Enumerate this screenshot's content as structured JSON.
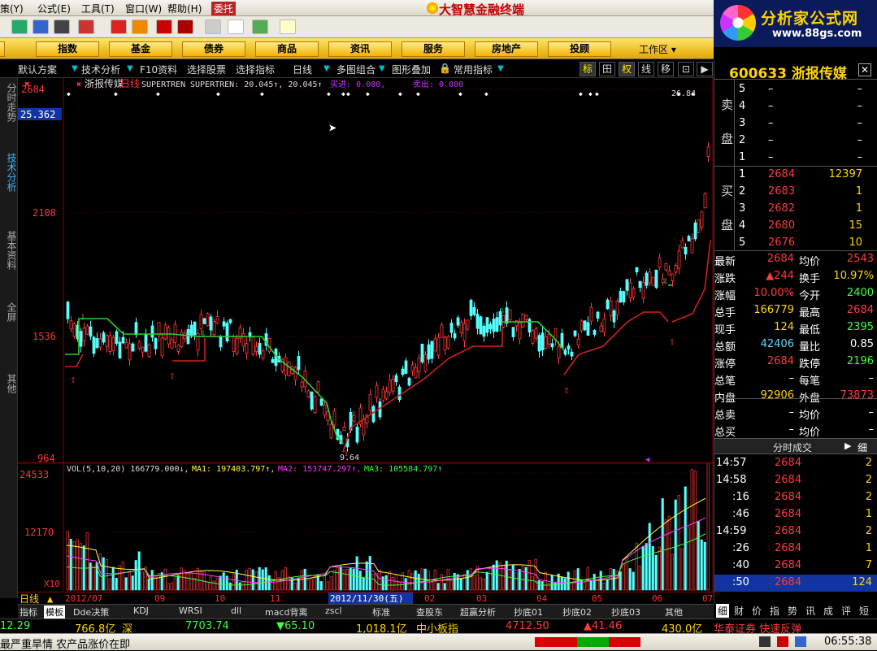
{
  "menu": {
    "items": [
      "策(Y)",
      "公式(E)",
      "工具(T)",
      "窗口(W)",
      "帮助(H)",
      "委托"
    ],
    "app_title": "大智慧金融终端"
  },
  "brand": {
    "name": "分析家公式网",
    "url": "www.88gs.com"
  },
  "categories": [
    "股",
    "指数",
    "基金",
    "债券",
    "商品",
    "资讯",
    "服务",
    "房地产",
    "投顾"
  ],
  "workarea_label": "工作区",
  "funcbar": {
    "items": [
      "默认方案",
      "技术分析",
      "F10资料",
      "选择股票",
      "选择指标",
      "日线",
      "多图组合",
      "图形叠加",
      "常用指标"
    ],
    "buttons": [
      "标",
      "田",
      "权",
      "线",
      "移"
    ]
  },
  "vtabs": [
    "分时走势",
    "技术分析",
    "基本资料",
    "全屏",
    "其他"
  ],
  "price_chart": {
    "header_name": "浙报传媒",
    "header_period": "日线",
    "indicator": "SUPERTREN",
    "indicator_line": "SUPERTREN: 20.045↑, 20.045↑",
    "buy_label": "买进: 0.000,",
    "sell_label": "卖出: 0.000",
    "y_labels": [
      "2684",
      "2108",
      "1536",
      "964"
    ],
    "cursor_value": "25.362",
    "high_mark": "26.84",
    "low_mark": "9.64"
  },
  "vol_chart": {
    "legend_vol": "VOL(5,10,20) 166779.000↓,",
    "legend_ma1": "MA1: 197403.797↑,",
    "legend_ma2": "MA2: 153747.297↑,",
    "legend_ma3": "MA3: 105584.797↑",
    "y_labels": [
      "24533",
      "12170",
      "X10"
    ]
  },
  "date_axis": {
    "labels": [
      "2012/07",
      "09",
      "10",
      "11",
      "2012/11/30(五)",
      "02",
      "03",
      "04",
      "05",
      "06",
      "07"
    ],
    "period_label": "日线"
  },
  "bottom_tabs": [
    "指标",
    "模板",
    "Dde决策",
    "KDJ",
    "WRSI",
    "dll",
    "macd背离",
    "zscl",
    "标准",
    "查股东",
    "超赢分析",
    "抄底01",
    "抄底02",
    "抄底03",
    "其他"
  ],
  "right_panel": {
    "stock_code": "600633",
    "stock_name": "浙报传媒",
    "sell_label": [
      "卖",
      "盘"
    ],
    "buy_label": [
      "买",
      "盘"
    ],
    "sell_rows": [
      {
        "level": "5",
        "price": "–",
        "vol": "–"
      },
      {
        "level": "4",
        "price": "–",
        "vol": "–"
      },
      {
        "level": "3",
        "price": "–",
        "vol": "–"
      },
      {
        "level": "2",
        "price": "–",
        "vol": "–"
      },
      {
        "level": "1",
        "price": "–",
        "vol": "–"
      }
    ],
    "buy_rows": [
      {
        "level": "1",
        "price": "2684",
        "vol": "12397"
      },
      {
        "level": "2",
        "price": "2683",
        "vol": "1"
      },
      {
        "level": "3",
        "price": "2682",
        "vol": "1"
      },
      {
        "level": "4",
        "price": "2680",
        "vol": "15"
      },
      {
        "level": "5",
        "price": "2676",
        "vol": "10"
      }
    ],
    "stats": [
      {
        "l1": "最新",
        "v1": "2684",
        "c1": "red",
        "l2": "均价",
        "v2": "2543",
        "c2": "red"
      },
      {
        "l1": "涨跌",
        "v1": "▲244",
        "c1": "red",
        "l2": "换手",
        "v2": "10.97%",
        "c2": "yellow"
      },
      {
        "l1": "涨幅",
        "v1": "10.00%",
        "c1": "red",
        "l2": "今开",
        "v2": "2400",
        "c2": "green"
      },
      {
        "l1": "总手",
        "v1": "166779",
        "c1": "yellow",
        "l2": "最高",
        "v2": "2684",
        "c2": "red"
      },
      {
        "l1": "现手",
        "v1": "124",
        "c1": "yellow",
        "l2": "最低",
        "v2": "2395",
        "c2": "green"
      },
      {
        "l1": "总额",
        "v1": "42406",
        "c1": "cyan",
        "l2": "量比",
        "v2": "0.85",
        "c2": "white"
      },
      {
        "l1": "涨停",
        "v1": "2684",
        "c1": "red",
        "l2": "跌停",
        "v2": "2196",
        "c2": "green"
      },
      {
        "l1": "总笔",
        "v1": "–",
        "c1": "white",
        "l2": "每笔",
        "v2": "–",
        "c2": "white"
      },
      {
        "l1": "内盘",
        "v1": "92906",
        "c1": "yellow",
        "l2": "外盘",
        "v2": "73873",
        "c2": "red"
      },
      {
        "l1": "总卖",
        "v1": "–",
        "c1": "white",
        "l2": "均价",
        "v2": "–",
        "c2": "white"
      },
      {
        "l1": "总买",
        "v1": "–",
        "c1": "white",
        "l2": "均价",
        "v2": "–",
        "c2": "white"
      }
    ],
    "ticks_title": "分时成交",
    "ticks_button": "细",
    "ticks": [
      {
        "time": "14:57",
        "price": "2684",
        "vol": "2"
      },
      {
        "time": "14:58",
        "price": "2684",
        "vol": "2"
      },
      {
        "time": ":16",
        "price": "2684",
        "vol": "2"
      },
      {
        "time": ":46",
        "price": "2684",
        "vol": "1"
      },
      {
        "time": "14:59",
        "price": "2684",
        "vol": "2"
      },
      {
        "time": ":26",
        "price": "2684",
        "vol": "1"
      },
      {
        "time": ":40",
        "price": "2684",
        "vol": "7"
      },
      {
        "time": ":50",
        "price": "2684",
        "vol": "124"
      }
    ],
    "tabs": [
      "细",
      "财",
      "价",
      "指",
      "势",
      "讯",
      "成",
      "评",
      "短"
    ]
  },
  "statusbar": {
    "idx1_val": "12.29",
    "idx1_amt": "766.8亿",
    "sz_label": "深",
    "sz_val": "7703.74",
    "sz_chg": "▼65.10",
    "sz_amt": "1,018.1亿",
    "zxb_label": "中小板指",
    "zxb_val": "4712.50",
    "zxb_chg": "▲41.46",
    "zxb_amt": "430.0亿",
    "broker_msg": "华泰证券 快速反弹"
  },
  "newsbar": {
    "text": "最严重旱情 农产品涨价在即",
    "time": "06:55:38"
  },
  "colors": {
    "up": "#ff3a3a",
    "down": "#3fff3f",
    "accent": "#ffd400"
  }
}
